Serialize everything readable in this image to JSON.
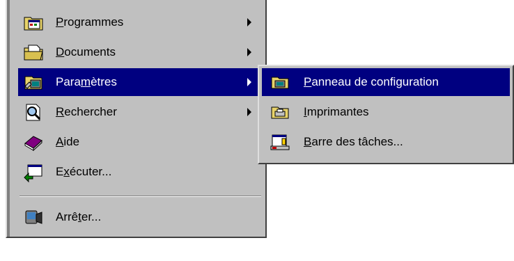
{
  "start_menu": {
    "items": [
      {
        "pre": "",
        "key": "P",
        "post": "rogrammes",
        "has_submenu": true,
        "icon": "programs-folder-icon"
      },
      {
        "pre": "",
        "key": "D",
        "post": "ocuments",
        "has_submenu": true,
        "icon": "documents-folder-icon"
      },
      {
        "pre": "Para",
        "key": "m",
        "post": "ètres",
        "has_submenu": true,
        "icon": "settings-icon"
      },
      {
        "pre": "",
        "key": "R",
        "post": "echercher",
        "has_submenu": true,
        "icon": "find-icon"
      },
      {
        "pre": "",
        "key": "A",
        "post": "ide",
        "has_submenu": false,
        "icon": "help-book-icon"
      },
      {
        "pre": "E",
        "key": "x",
        "post": "écuter...",
        "has_submenu": false,
        "icon": "run-icon"
      },
      {
        "pre": "Arrê",
        "key": "t",
        "post": "er...",
        "has_submenu": false,
        "icon": "shutdown-icon"
      }
    ]
  },
  "submenu": {
    "items": [
      {
        "pre": "",
        "key": "P",
        "post": "anneau de configuration",
        "icon": "control-panel-icon"
      },
      {
        "pre": "",
        "key": "I",
        "post": "mprimantes",
        "icon": "printers-icon"
      },
      {
        "pre": "",
        "key": "B",
        "post": "arre des tâches...",
        "icon": "taskbar-icon"
      }
    ]
  },
  "colors": {
    "menu_bg": "#c0c0c0",
    "highlight": "#000080",
    "highlight_text": "#ffffff"
  }
}
